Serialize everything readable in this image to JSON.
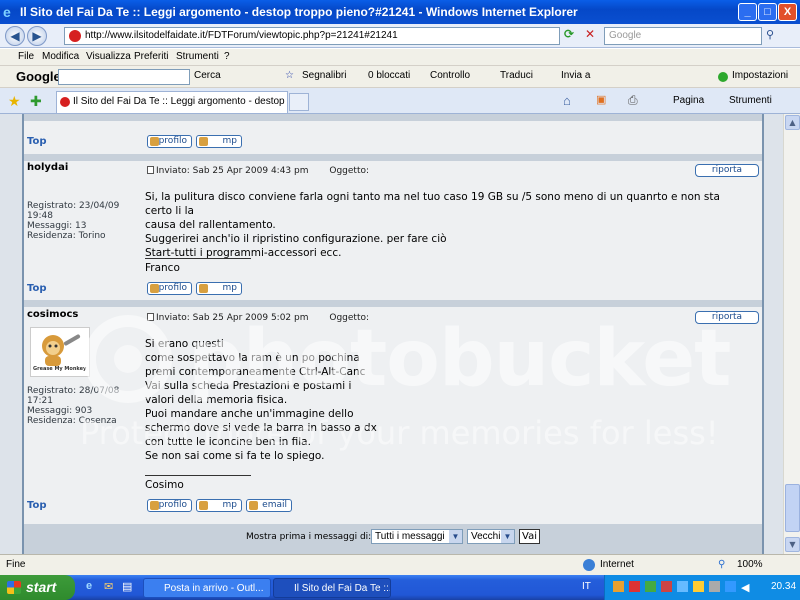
{
  "window": {
    "title": "Il Sito del Fai Da Te :: Leggi argomento - destop troppo pieno?#21241 - Windows Internet Explorer",
    "minimize": "_",
    "maximize": "□",
    "close": "X"
  },
  "address": {
    "url": "http://www.ilsitodelfaidate.it/FDTForum/viewtopic.php?p=21241#21241",
    "search_placeholder": "Google"
  },
  "menu": [
    "File",
    "Modifica",
    "Visualizza",
    "Preferiti",
    "Strumenti",
    "?"
  ],
  "google_toolbar": {
    "logo": "Google",
    "search_btn": "Cerca",
    "bookmarks": "Segnalibri",
    "blocked": "0 bloccati",
    "check": "Controllo",
    "translate": "Traduci",
    "send": "Invia a",
    "settings": "Impostazioni"
  },
  "tabs": {
    "active": "Il Sito del Fai Da Te :: Leggi argomento - destop tropp...",
    "page_menu": "Pagina",
    "tools_menu": "Strumenti"
  },
  "forum": {
    "top_label": "Top",
    "btn_profile": "profilo",
    "btn_pm": "mp",
    "btn_email": "email",
    "btn_report": "riporta",
    "posts": [
      {
        "author": "holydai",
        "meta": [
          "Registrato: 23/04/09",
          "19:48",
          "Messaggi: 13",
          "Residenza: Torino"
        ],
        "posted": "Inviato: Sab 25 Apr 2009 4:43 pm",
        "subject_label": "Oggetto:",
        "body": [
          "Si, la pulitura disco conviene farla ogni tanto ma nel tuo caso 19 GB su /5 sono meno di un quanrto e non sta certo li la",
          "causa del rallentamento.",
          "Suggerirei anch'io il ripristino configurazione. per fare ciò",
          "Start-tutti i programmi-accessori ecc."
        ],
        "signature": "Franco"
      },
      {
        "author": "cosimocs",
        "avatar_caption": "Grease My Monkey",
        "meta": [
          "Registrato: 28/07/08",
          "17:21",
          "Messaggi: 903",
          "Residenza: Cosenza"
        ],
        "posted": "Inviato: Sab 25 Apr 2009 5:02 pm",
        "subject_label": "Oggetto:",
        "body": [
          "Si erano questi",
          "come sospettavo la ram è un po pochina",
          "premi contemporaneamente Ctrl-Alt-Canc",
          "Vai sulla scheda Prestazioni e postami i",
          "valori della memoria fisica.",
          "Puoi mandare anche un'immagine dello",
          "schermo dove si vede la barra in basso a dx",
          "con tutte le iconcine ben in fila.",
          "Se non sai come si fa te lo spiego."
        ],
        "signature": "Cosimo"
      }
    ],
    "bottom": {
      "label": "Mostra prima i messaggi di:",
      "filter": "Tutti i messaggi",
      "order": "Vecchi",
      "go": "Vai"
    }
  },
  "watermark": {
    "brand": "photobucket",
    "tagline": "Protect more of your memories for less!"
  },
  "status": {
    "text": "Fine",
    "zone": "Internet",
    "zoom": "100%"
  },
  "taskbar": {
    "start": "start",
    "tasks": [
      "Posta in arrivo - Outl...",
      "Il Sito del Fai Da Te ::..."
    ],
    "lang": "IT",
    "clock": "20.34"
  }
}
